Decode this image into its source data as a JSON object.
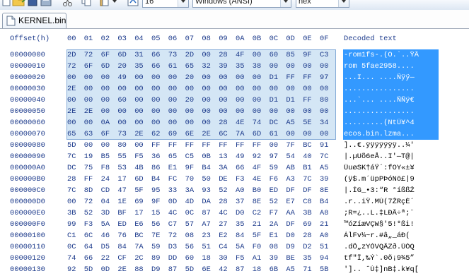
{
  "toolbar": {
    "offset_base": "16",
    "charset": "Windows (ANSI)",
    "display_mode": "hex",
    "icons": [
      "new-file-icon",
      "open-folder-icon",
      "save-icon",
      "print-icon",
      "disk-icon",
      "page-icon",
      "jump-icon",
      "cut-icon",
      "copy-icon",
      "paste-icon"
    ]
  },
  "tab": {
    "label": "KERNEL.bin"
  },
  "header": {
    "offset_label": "Offset(h)",
    "columns": [
      "00",
      "01",
      "02",
      "03",
      "04",
      "05",
      "06",
      "07",
      "08",
      "09",
      "0A",
      "0B",
      "0C",
      "0D",
      "0E",
      "0F"
    ],
    "decoded_label": "Decoded text"
  },
  "rows": [
    {
      "offset": "00000000",
      "bytes": [
        "2D",
        "72",
        "6F",
        "6D",
        "31",
        "66",
        "73",
        "2D",
        "00",
        "28",
        "4F",
        "00",
        "60",
        "85",
        "9F",
        "C3"
      ],
      "text": "-rom1fs-.(O.`..ŸÃ",
      "selected": true
    },
    {
      "offset": "00000010",
      "bytes": [
        "72",
        "6F",
        "6D",
        "20",
        "35",
        "66",
        "61",
        "65",
        "32",
        "39",
        "35",
        "38",
        "00",
        "00",
        "00",
        "00"
      ],
      "text": "rom 5fae2958....",
      "selected": true
    },
    {
      "offset": "00000020",
      "bytes": [
        "00",
        "00",
        "00",
        "49",
        "00",
        "00",
        "00",
        "20",
        "00",
        "00",
        "00",
        "00",
        "D1",
        "FF",
        "FF",
        "97"
      ],
      "text": "...I... ....Ñÿÿ—",
      "selected": true
    },
    {
      "offset": "00000030",
      "bytes": [
        "2E",
        "00",
        "00",
        "00",
        "00",
        "00",
        "00",
        "00",
        "00",
        "00",
        "00",
        "00",
        "00",
        "00",
        "00",
        "00"
      ],
      "text": "................",
      "selected": true
    },
    {
      "offset": "00000040",
      "bytes": [
        "00",
        "00",
        "00",
        "60",
        "00",
        "00",
        "00",
        "20",
        "00",
        "00",
        "00",
        "00",
        "D1",
        "D1",
        "FF",
        "80"
      ],
      "text": "...`... ....ÑÑÿ€",
      "selected": true
    },
    {
      "offset": "00000050",
      "bytes": [
        "2E",
        "2E",
        "00",
        "00",
        "00",
        "00",
        "00",
        "00",
        "00",
        "00",
        "00",
        "00",
        "00",
        "00",
        "00",
        "00"
      ],
      "text": "................",
      "selected": true
    },
    {
      "offset": "00000060",
      "bytes": [
        "00",
        "00",
        "0A",
        "00",
        "00",
        "00",
        "00",
        "00",
        "00",
        "28",
        "4E",
        "74",
        "DC",
        "A5",
        "5E",
        "34"
      ],
      "text": ".........(NtÜ¥^4",
      "selected": true
    },
    {
      "offset": "00000070",
      "bytes": [
        "65",
        "63",
        "6F",
        "73",
        "2E",
        "62",
        "69",
        "6E",
        "2E",
        "6C",
        "7A",
        "6D",
        "61",
        "00",
        "00",
        "00"
      ],
      "text": "ecos.bin.lzma...",
      "selected": true
    },
    {
      "offset": "00000080",
      "bytes": [
        "5D",
        "00",
        "00",
        "80",
        "00",
        "FF",
        "FF",
        "FF",
        "FF",
        "FF",
        "FF",
        "FF",
        "00",
        "7F",
        "BC",
        "91"
      ],
      "text": "]..€.ÿÿÿÿÿÿÿ..¼'",
      "selected": false
    },
    {
      "offset": "00000090",
      "bytes": [
        "7C",
        "19",
        "B5",
        "55",
        "F5",
        "36",
        "65",
        "C5",
        "0B",
        "13",
        "49",
        "92",
        "97",
        "54",
        "40",
        "7C"
      ],
      "text": "|.µUõ6eÅ..I'—T@|",
      "selected": false
    },
    {
      "offset": "000000A0",
      "bytes": [
        "DC",
        "75",
        "F8",
        "53",
        "4B",
        "86",
        "E1",
        "9F",
        "B4",
        "3A",
        "66",
        "4F",
        "59",
        "AB",
        "B1",
        "A5"
      ],
      "text": "ÜuøSK†áŸ´:fOY«±¥",
      "selected": false
    },
    {
      "offset": "000000B0",
      "bytes": [
        "28",
        "FF",
        "24",
        "17",
        "6D",
        "B4",
        "FC",
        "70",
        "50",
        "DE",
        "F3",
        "4E",
        "F6",
        "A3",
        "7C",
        "39"
      ],
      "text": "(ÿ$.m´üpPÞóNö£|9",
      "selected": false
    },
    {
      "offset": "000000C0",
      "bytes": [
        "7C",
        "8D",
        "CD",
        "47",
        "5F",
        "95",
        "33",
        "3A",
        "93",
        "52",
        "A0",
        "B0",
        "ED",
        "DF",
        "DF",
        "8E"
      ],
      "text": "|.ÍG_•3:“R °íßßŽ",
      "selected": false
    },
    {
      "offset": "000000D0",
      "bytes": [
        "00",
        "72",
        "04",
        "1E",
        "69",
        "9F",
        "0D",
        "4D",
        "DA",
        "28",
        "37",
        "8E",
        "52",
        "E7",
        "C8",
        "B4"
      ],
      "text": ".r..iŸ.MÚ(7ŽRçÈ´",
      "selected": false
    },
    {
      "offset": "000000E0",
      "bytes": [
        "3B",
        "52",
        "3D",
        "BF",
        "17",
        "15",
        "4C",
        "0C",
        "87",
        "4C",
        "D0",
        "C2",
        "F7",
        "AA",
        "3B",
        "A8"
      ],
      "text": ";R=¿..L.‡LÐÂ÷ª;¨",
      "selected": false
    },
    {
      "offset": "000000F0",
      "bytes": [
        "99",
        "F3",
        "5A",
        "ED",
        "E6",
        "56",
        "C7",
        "57",
        "A7",
        "27",
        "35",
        "21",
        "2A",
        "DF",
        "69",
        "21"
      ],
      "text": "™óZíæVÇW§'5!*ßi!",
      "selected": false
    },
    {
      "offset": "00000100",
      "bytes": [
        "C1",
        "6C",
        "46",
        "76",
        "BC",
        "7E",
        "72",
        "08",
        "23",
        "E2",
        "84",
        "5F",
        "E1",
        "D0",
        "28",
        "A0"
      ],
      "text": "ÁlFv¼~r.#â„_áÐ( ",
      "selected": false
    },
    {
      "offset": "00000110",
      "bytes": [
        "0C",
        "64",
        "D5",
        "84",
        "7A",
        "59",
        "D3",
        "56",
        "51",
        "C4",
        "5A",
        "F0",
        "08",
        "D9",
        "D2",
        "51"
      ],
      "text": ".dÕ„zYÓVQÄZð.ÙÒQ",
      "selected": false
    },
    {
      "offset": "00000120",
      "bytes": [
        "74",
        "66",
        "22",
        "CF",
        "2C",
        "89",
        "DD",
        "60",
        "18",
        "30",
        "F5",
        "A1",
        "39",
        "BE",
        "35",
        "94"
      ],
      "text": "tf\"Ï,‰Ý`.0õ¡9¾5”",
      "selected": false
    },
    {
      "offset": "00000130",
      "bytes": [
        "92",
        "5D",
        "0D",
        "2E",
        "88",
        "D9",
        "87",
        "5D",
        "6E",
        "42",
        "87",
        "18",
        "6B",
        "A5",
        "71",
        "5B"
      ],
      "text": "'].. ˆÙ‡]nB‡.k¥q[",
      "selected": false
    }
  ]
}
